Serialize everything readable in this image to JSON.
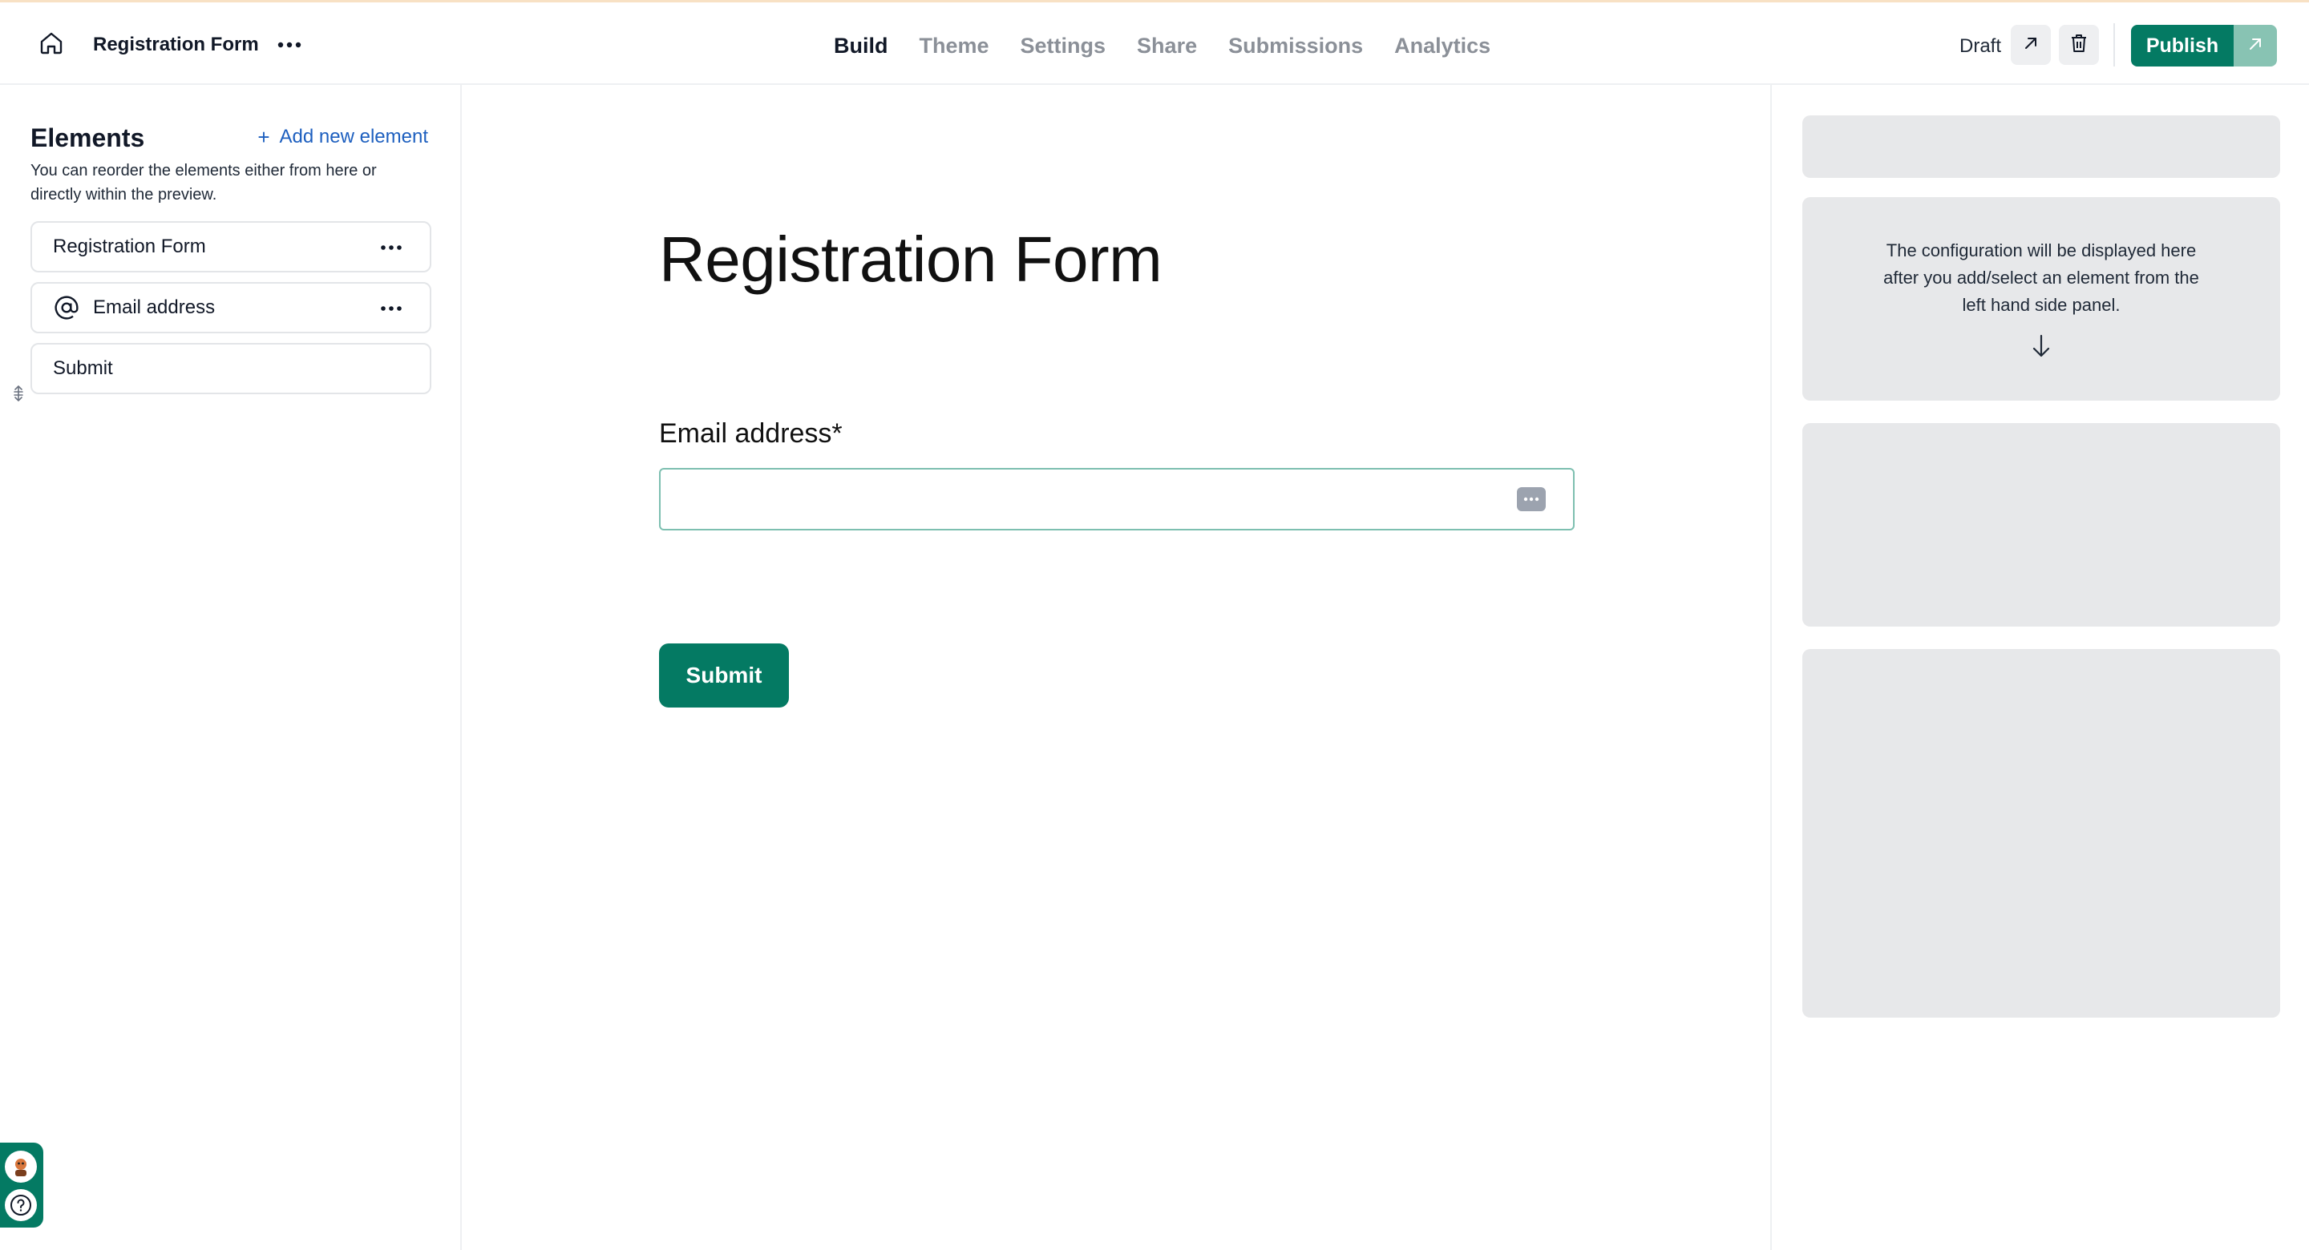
{
  "header": {
    "form_name": "Registration Form",
    "tabs": [
      {
        "label": "Build",
        "active": true
      },
      {
        "label": "Theme",
        "active": false
      },
      {
        "label": "Settings",
        "active": false
      },
      {
        "label": "Share",
        "active": false
      },
      {
        "label": "Submissions",
        "active": false
      },
      {
        "label": "Analytics",
        "active": false
      }
    ],
    "status": "Draft",
    "publish_label": "Publish"
  },
  "sidebar": {
    "title": "Elements",
    "add_label": "Add new element",
    "help_text": "You can reorder the elements either from here or directly within the preview.",
    "items": [
      {
        "label": "Registration Form",
        "icon": "none"
      },
      {
        "label": "Email address",
        "icon": "at-sign-icon"
      },
      {
        "label": "Submit",
        "icon": "none"
      }
    ]
  },
  "preview": {
    "title": "Registration Form",
    "email_label": "Email address*",
    "email_value": "",
    "submit_label": "Submit"
  },
  "config": {
    "message": "The configuration will be displayed here after you add/select an element from the left hand side panel."
  },
  "colors": {
    "accent": "#047a63",
    "link": "#1d5fbf",
    "panel_bg": "#e7e8ea"
  }
}
